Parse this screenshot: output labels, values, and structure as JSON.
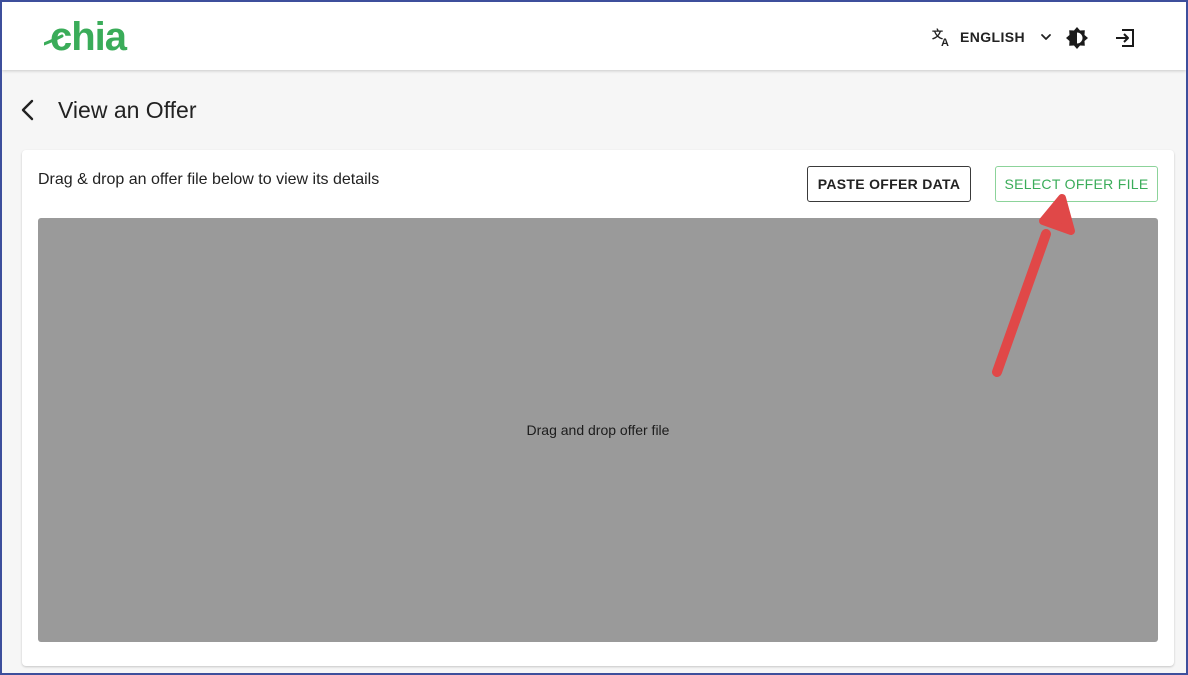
{
  "header": {
    "logo_text": "chia",
    "language": {
      "label": "ENGLISH",
      "icon": "translate-icon",
      "dropdown_icon": "chevron-down-icon"
    },
    "theme_icon": "brightness-icon",
    "logout_icon": "logout-icon"
  },
  "page": {
    "back_icon": "chevron-left-icon",
    "title": "View an Offer"
  },
  "card": {
    "description": "Drag & drop an offer file below to view its details",
    "paste_button": "PASTE OFFER DATA",
    "select_button": "SELECT OFFER FILE",
    "dropzone_text": "Drag and drop offer file"
  },
  "colors": {
    "brand_green": "#3aac59",
    "annotation_arrow": "#e04848",
    "dropzone_bg": "#9a9a9a"
  }
}
